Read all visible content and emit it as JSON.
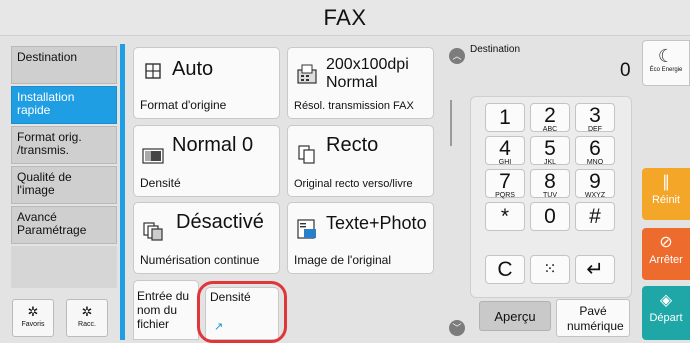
{
  "window": {
    "title": "FAX"
  },
  "sidebar": {
    "items": [
      {
        "label": "Destination",
        "active": false
      },
      {
        "label": "Installation rapide",
        "active": true
      },
      {
        "label": "Format orig. /transmis.",
        "active": false
      },
      {
        "label": "Qualité de l'image",
        "active": false
      },
      {
        "label": "Avancé Paramétrage",
        "active": false
      }
    ],
    "favorites_label": "Favoris",
    "shortcuts_label": "Racc."
  },
  "settings": {
    "original_size": {
      "value": "Auto",
      "label": "Format d'origine"
    },
    "tx_resolution": {
      "value": "200x100dpi Normal",
      "label": "Résol. transmission FAX"
    },
    "density": {
      "value": "Normal 0",
      "label": "Densité"
    },
    "duplex": {
      "value": "Recto",
      "label": "Original recto verso/livre"
    },
    "continuous_scan": {
      "value": "Désactivé",
      "label": "Numérisation continue"
    },
    "original_image": {
      "value": "Texte+Photo",
      "label": "Image de l'original"
    },
    "file_name_entry": {
      "label": "Entrée du nom du fichier"
    },
    "density_shortcut": {
      "label": "Densité"
    }
  },
  "destination": {
    "label": "Destination",
    "count": "0"
  },
  "keypad": {
    "keys": [
      {
        "num": "1",
        "letters": ""
      },
      {
        "num": "2",
        "letters": "ABC"
      },
      {
        "num": "3",
        "letters": "DEF"
      },
      {
        "num": "4",
        "letters": "GHI"
      },
      {
        "num": "5",
        "letters": "JKL"
      },
      {
        "num": "6",
        "letters": "MNO"
      },
      {
        "num": "7",
        "letters": "PQRS"
      },
      {
        "num": "8",
        "letters": "TUV"
      },
      {
        "num": "9",
        "letters": "WXYZ"
      },
      {
        "num": "*",
        "letters": ""
      },
      {
        "num": "0",
        "letters": ""
      },
      {
        "num": "#",
        "letters": ""
      }
    ],
    "clear_label": "C",
    "enter_symbol": "↵"
  },
  "bottom": {
    "preview_label": "Aperçu",
    "numpad_label": "Pavé numérique"
  },
  "right": {
    "eco_label": "Éco Energie",
    "reset_label": "Réinit",
    "stop_label": "Arrêter",
    "start_label": "Départ"
  },
  "colors": {
    "accent": "#1f9ee3",
    "reset": "#f3a628",
    "stop": "#ee6b2e",
    "start": "#1fa6a6",
    "highlight": "#e0353a"
  }
}
